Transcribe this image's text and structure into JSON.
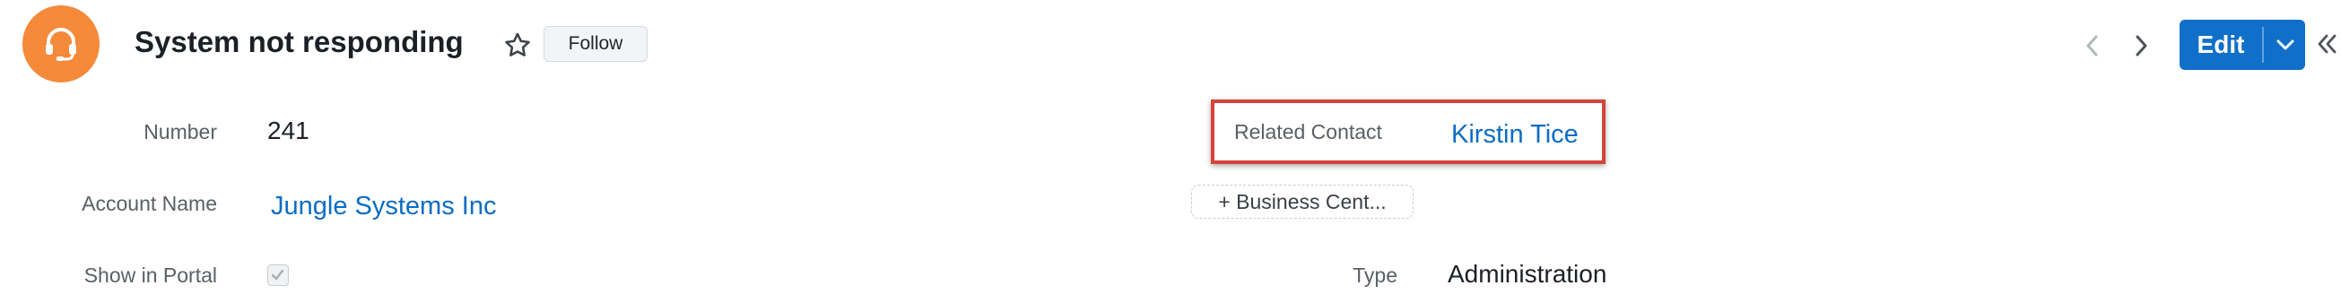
{
  "header": {
    "title": "System not responding",
    "follow_label": "Follow",
    "edit_label": "Edit",
    "avatar_icon": "headset-icon",
    "accent_color": "#f48a3a",
    "primary_color": "#0f6fc9"
  },
  "fields": {
    "number": {
      "label": "Number",
      "value": "241"
    },
    "account_name": {
      "label": "Account Name",
      "value": "Jungle Systems Inc"
    },
    "show_in_portal": {
      "label": "Show in Portal",
      "checked": true
    },
    "related_contact": {
      "label": "Related Contact",
      "value": "Kirstin Tice"
    },
    "business_center": {
      "label": "+ Business Cent..."
    },
    "type": {
      "label": "Type",
      "value": "Administration"
    }
  }
}
